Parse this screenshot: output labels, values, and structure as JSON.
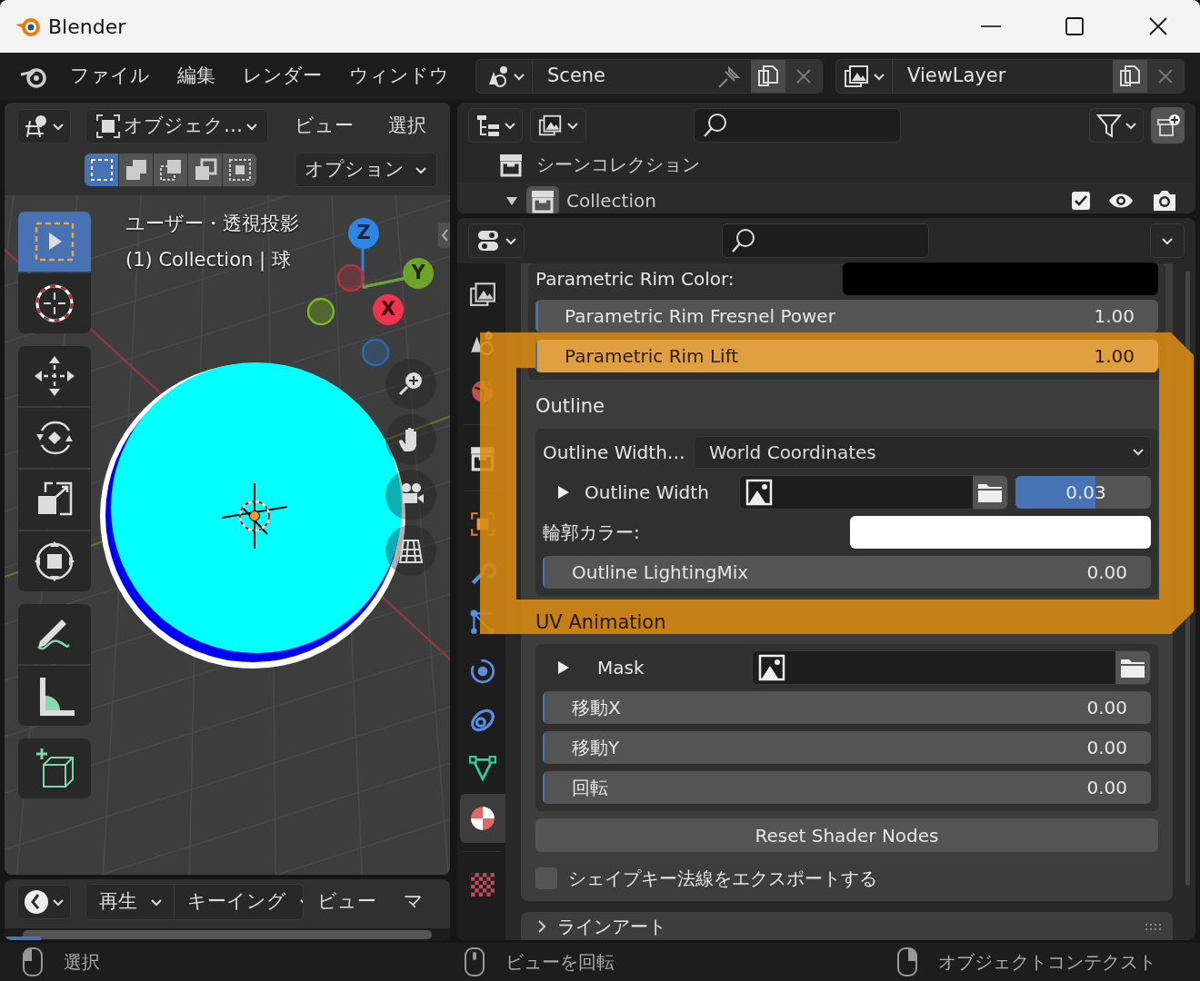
{
  "window": {
    "title": "Blender"
  },
  "menu_bar": {
    "items": [
      "ファイル",
      "編集",
      "レンダー",
      "ウィンドウ"
    ]
  },
  "scene_selector": {
    "value": "Scene"
  },
  "view_layer_selector": {
    "value": "ViewLayer"
  },
  "viewport": {
    "mode": "オブジェク…",
    "menus": [
      "ビュー",
      "選択"
    ],
    "options": "オプション",
    "select_modes": [
      {
        "kind": "new",
        "selected": true
      },
      {
        "kind": "extend",
        "selected": false
      },
      {
        "kind": "subtract",
        "selected": false
      },
      {
        "kind": "invert",
        "selected": false
      },
      {
        "kind": "intersect",
        "selected": false
      }
    ],
    "overlay_text": [
      "ユーザー・透視投影",
      "(1) Collection | 球"
    ],
    "tool_groups": [
      [
        {
          "kind": "select",
          "selected": true
        },
        {
          "kind": "cursor",
          "selected": false
        }
      ],
      [
        {
          "kind": "move",
          "selected": false
        },
        {
          "kind": "rotate",
          "selected": false
        },
        {
          "kind": "scale",
          "selected": false
        },
        {
          "kind": "transform",
          "selected": false
        }
      ],
      [
        {
          "kind": "annotate",
          "selected": false
        },
        {
          "kind": "measure",
          "selected": false
        }
      ],
      [
        {
          "kind": "add",
          "selected": false
        }
      ]
    ],
    "gizmo_axes": [
      "Z",
      "Y",
      "X"
    ]
  },
  "timeline": {
    "menus": [
      {
        "label": "再生",
        "dropdown": true
      },
      {
        "label": "キーイング",
        "dropdown": true
      },
      {
        "label": "ビュー",
        "dropdown": false
      },
      {
        "label": "マ",
        "dropdown": false
      }
    ]
  },
  "outliner": {
    "items": [
      {
        "label": "シーンコレクション",
        "children": [
          {
            "label": "Collection",
            "expanded": true,
            "checked": true
          }
        ]
      }
    ]
  },
  "properties": {
    "tabs": [
      {
        "kind": "render",
        "selected": false
      },
      {
        "kind": "scene",
        "selected": false
      },
      {
        "kind": "world",
        "selected": false
      },
      {
        "kind": "collection",
        "selected": false
      },
      {
        "kind": "object",
        "selected": false
      },
      {
        "kind": "modifier",
        "selected": false
      },
      {
        "kind": "particles",
        "selected": false
      },
      {
        "kind": "physics",
        "selected": false
      },
      {
        "kind": "constraint",
        "selected": false
      },
      {
        "kind": "data",
        "selected": false
      },
      {
        "kind": "material",
        "selected": true
      },
      {
        "kind": "texture",
        "selected": false
      }
    ],
    "rows": [
      {
        "kind": "color",
        "label": "Parametric Rim Color:",
        "color": "#000000"
      },
      {
        "kind": "slider",
        "label": "Parametric Rim Fresnel Power",
        "value": "1.00",
        "level": 0.005
      },
      {
        "kind": "slider",
        "label": "Parametric Rim Lift",
        "value": "1.00",
        "level": 0
      }
    ],
    "sections": [
      {
        "title": "Outline",
        "rows": [
          {
            "kind": "dropdown",
            "label": "Outline Width…",
            "value": "World Coordinates"
          },
          {
            "kind": "texture",
            "label": "Outline Width",
            "expanded": false,
            "value": "0.03",
            "level": 0.59
          },
          {
            "kind": "color",
            "label": "輪郭カラー:",
            "color": "#ffffff"
          },
          {
            "kind": "slider",
            "label": "Outline LightingMix",
            "value": "0.00",
            "level": 0
          }
        ]
      },
      {
        "title": "UV Animation",
        "rows": [
          {
            "kind": "texture",
            "label": "Mask",
            "expanded": false
          },
          {
            "kind": "slider",
            "label": "移動X",
            "value": "0.00",
            "level": 0
          },
          {
            "kind": "slider",
            "label": "移動Y",
            "value": "0.00",
            "level": 0
          },
          {
            "kind": "slider",
            "label": "回転",
            "value": "0.00",
            "level": 0
          }
        ]
      }
    ],
    "reset_button": "Reset Shader Nodes",
    "export_checkbox": {
      "label": "シェイプキー法線をエクスポートする",
      "checked": false
    },
    "collapsed_panel": {
      "title": "ラインアート",
      "expanded": false
    }
  },
  "status_bar": [
    {
      "label": "選択",
      "kind": "left"
    },
    {
      "label": "ビューを回転",
      "kind": "middle"
    },
    {
      "label": "オブジェクトコンテクスト",
      "kind": "right"
    }
  ]
}
